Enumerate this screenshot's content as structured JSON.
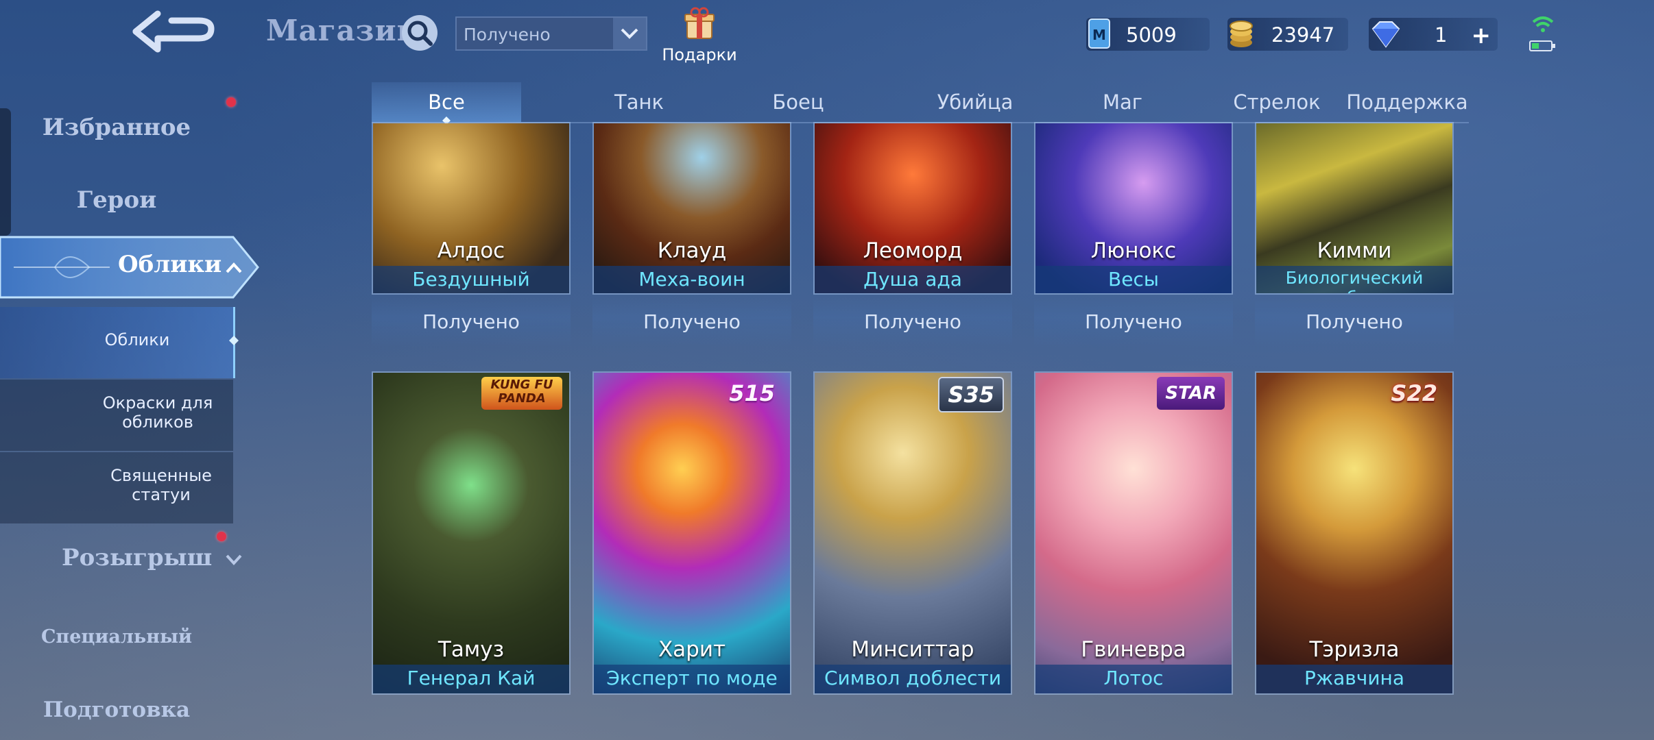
{
  "header": {
    "title": "Магазин",
    "filter_value": "Получено",
    "gifts_label": "Подарки",
    "currencies": [
      {
        "icon": "diamond-ticket-icon",
        "value": "5009"
      },
      {
        "icon": "gold-coins-icon",
        "value": "23947"
      },
      {
        "icon": "gem-icon",
        "value": "1"
      }
    ],
    "add_symbol": "+"
  },
  "sidebar": {
    "favorites": "Избранное",
    "heroes": "Герои",
    "skins": "Облики",
    "sub": {
      "skins": "Облики",
      "skin_colors": "Окраски для обликов",
      "statues": "Священные статуи"
    },
    "draw": "Розыгрыш",
    "special": "Специальный",
    "prep": "Подготовка"
  },
  "tabs": [
    "Все",
    "Танк",
    "Боец",
    "Убийца",
    "Маг",
    "Стрелок",
    "Поддержка"
  ],
  "status_received": "Получено",
  "row1": [
    {
      "hero": "Алдос",
      "skin": "Бездушный"
    },
    {
      "hero": "Клауд",
      "skin": "Меха-воин"
    },
    {
      "hero": "Леоморд",
      "skin": "Душа ада"
    },
    {
      "hero": "Люнокс",
      "skin": "Весы"
    },
    {
      "hero": "Кимми",
      "skin": "Биологический рубеж"
    }
  ],
  "row2": [
    {
      "hero": "Тамуз",
      "skin": "Генерал Кай",
      "badge": "KUNG FU PANDA"
    },
    {
      "hero": "Харит",
      "skin": "Эксперт по моде",
      "badge": "515"
    },
    {
      "hero": "Минситтар",
      "skin": "Символ доблести",
      "badge": "S35"
    },
    {
      "hero": "Гвиневра",
      "skin": "Лотос",
      "badge": "STAR"
    },
    {
      "hero": "Тэризла",
      "skin": "Ржавчина",
      "badge": "S22"
    }
  ]
}
